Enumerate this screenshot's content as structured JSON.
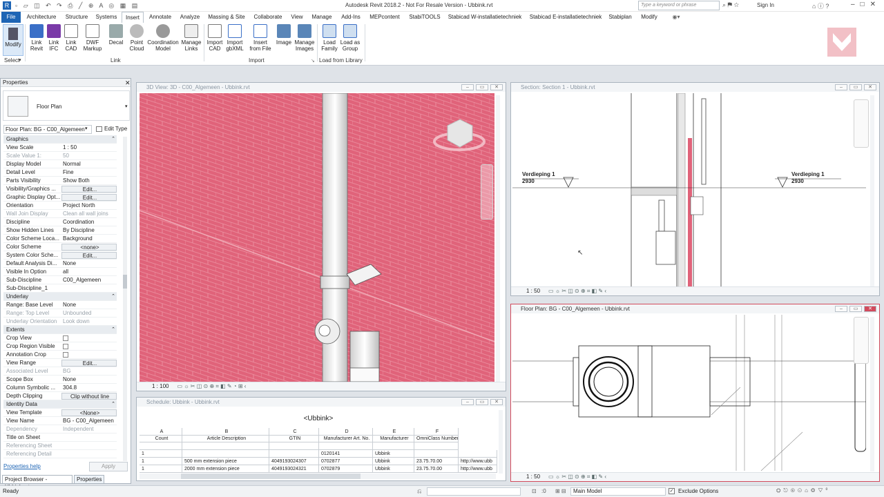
{
  "app": {
    "title": "Autodesk Revit 2018.2 - Not For Resale Version -    Ubbink.rvt",
    "search_placeholder": "Type a keyword or phrase",
    "sign_in": "Sign In"
  },
  "tabs": [
    "File",
    "Architecture",
    "Structure",
    "Systems",
    "Insert",
    "Annotate",
    "Analyze",
    "Massing & Site",
    "Collaborate",
    "View",
    "Manage",
    "Add-Ins",
    "MEPcontent",
    "StabiTOOLS",
    "Stabicad W-installatietechniek",
    "Stabicad E-installatietechniek",
    "Stabiplan",
    "Modify"
  ],
  "ribbon": {
    "modify": "Modify",
    "select": "Select",
    "link_group": "Link",
    "import_group": "Import",
    "library_group": "Load from Library",
    "buttons": [
      {
        "l1": "Link",
        "l2": "Revit"
      },
      {
        "l1": "Link",
        "l2": "IFC"
      },
      {
        "l1": "Link",
        "l2": "CAD"
      },
      {
        "l1": "DWF",
        "l2": "Markup"
      },
      {
        "l1": "Decal",
        "l2": ""
      },
      {
        "l1": "Point",
        "l2": "Cloud"
      },
      {
        "l1": "Coordination",
        "l2": "Model"
      },
      {
        "l1": "Manage",
        "l2": "Links"
      },
      {
        "l1": "Import",
        "l2": "CAD"
      },
      {
        "l1": "Import",
        "l2": "gbXML"
      },
      {
        "l1": "Insert",
        "l2": "from File"
      },
      {
        "l1": "Image",
        "l2": ""
      },
      {
        "l1": "Manage",
        "l2": "Images"
      },
      {
        "l1": "Load",
        "l2": "Family"
      },
      {
        "l1": "Load as",
        "l2": "Group"
      }
    ]
  },
  "properties": {
    "title": "Properties",
    "type": "Floor Plan",
    "selector": "Floor Plan: BG - C00_Algemeen",
    "edit_type": "Edit Type",
    "rows": [
      {
        "k": "Graphics",
        "v": "",
        "t": "sec"
      },
      {
        "k": "View Scale",
        "v": "1 : 50",
        "t": ""
      },
      {
        "k": "Scale Value    1:",
        "v": "50",
        "t": "dim"
      },
      {
        "k": "Display Model",
        "v": "Normal",
        "t": ""
      },
      {
        "k": "Detail Level",
        "v": "Fine",
        "t": ""
      },
      {
        "k": "Parts Visibility",
        "v": "Show Both",
        "t": ""
      },
      {
        "k": "Visibility/Graphics ...",
        "v": "Edit...",
        "t": "btn"
      },
      {
        "k": "Graphic Display Opt...",
        "v": "Edit...",
        "t": "btn"
      },
      {
        "k": "Orientation",
        "v": "Project North",
        "t": ""
      },
      {
        "k": "Wall Join Display",
        "v": "Clean all wall joins",
        "t": "dim"
      },
      {
        "k": "Discipline",
        "v": "Coordination",
        "t": ""
      },
      {
        "k": "Show Hidden Lines",
        "v": "By Discipline",
        "t": ""
      },
      {
        "k": "Color Scheme Loca...",
        "v": "Background",
        "t": ""
      },
      {
        "k": "Color Scheme",
        "v": "<none>",
        "t": "btn"
      },
      {
        "k": "System Color Sche...",
        "v": "Edit...",
        "t": "btn"
      },
      {
        "k": "Default Analysis Di...",
        "v": "None",
        "t": ""
      },
      {
        "k": "Visible In Option",
        "v": "all",
        "t": ""
      },
      {
        "k": "Sub-Discipline",
        "v": "C00_Algemeen",
        "t": ""
      },
      {
        "k": "Sub-Discipline_1",
        "v": "",
        "t": ""
      },
      {
        "k": "Underlay",
        "v": "",
        "t": "sec"
      },
      {
        "k": "Range: Base Level",
        "v": "None",
        "t": ""
      },
      {
        "k": "Range: Top Level",
        "v": "Unbounded",
        "t": "dim"
      },
      {
        "k": "Underlay Orientation",
        "v": "Look down",
        "t": "dim"
      },
      {
        "k": "Extents",
        "v": "",
        "t": "sec"
      },
      {
        "k": "Crop View",
        "v": "",
        "t": "check"
      },
      {
        "k": "Crop Region Visible",
        "v": "",
        "t": "check"
      },
      {
        "k": "Annotation Crop",
        "v": "",
        "t": "check"
      },
      {
        "k": "View Range",
        "v": "Edit...",
        "t": "btn"
      },
      {
        "k": "Associated Level",
        "v": "BG",
        "t": "dim"
      },
      {
        "k": "Scope Box",
        "v": "None",
        "t": ""
      },
      {
        "k": "Column Symbolic ...",
        "v": "304.8",
        "t": ""
      },
      {
        "k": "Depth Clipping",
        "v": "Clip without line",
        "t": "btn"
      },
      {
        "k": "Identity Data",
        "v": "",
        "t": "sec"
      },
      {
        "k": "View Template",
        "v": "<None>",
        "t": "btn"
      },
      {
        "k": "View Name",
        "v": "BG - C00_Algemeen",
        "t": ""
      },
      {
        "k": "Dependency",
        "v": "Independent",
        "t": "dim"
      },
      {
        "k": "Title on Sheet",
        "v": "",
        "t": ""
      },
      {
        "k": "Referencing Sheet",
        "v": "",
        "t": "dim"
      },
      {
        "k": "Referencing Detail",
        "v": "",
        "t": "dim"
      }
    ],
    "help": "Properties help",
    "apply": "Apply"
  },
  "bottom_tabs": [
    "Project Browser - Ubbink.rvt",
    "Properties"
  ],
  "views": {
    "v3d": {
      "title": "3D View: 3D - C00_Algemeen - Ubbink.rvt",
      "scale": "1 : 100"
    },
    "section": {
      "title": "Section: Section 1 - Ubbink.rvt",
      "scale": "1 : 50",
      "level": "Verdieping 1",
      "elev": "2930"
    },
    "plan": {
      "title": "Floor Plan: BG - C00_Algemeen - Ubbink.rvt",
      "scale": "1 : 50"
    },
    "schedule": {
      "title": "Schedule: Ubbink - Ubbink.rvt",
      "name": "<Ubbink>",
      "letters": [
        "A",
        "B",
        "C",
        "D",
        "E",
        "F"
      ],
      "headers": [
        "Count",
        "Article Description",
        "GTIN",
        "Manufacturer Art. No.",
        "Manufacturer",
        "OmniClass Number"
      ],
      "rows": [
        [
          "",
          "",
          "",
          "",
          "",
          ""
        ],
        [
          "1",
          "",
          "",
          "0120141",
          "Ubbink",
          "",
          ""
        ],
        [
          "1",
          "500 mm extension piece",
          "4049193024307",
          "0702877",
          "Ubbink",
          "23.75.70.00",
          "http://www.ubb"
        ],
        [
          "1",
          "2000 mm extension piece",
          "4049193024321",
          "0702879",
          "Ubbink",
          "23.75.70.00",
          "http://www.ubb"
        ]
      ]
    }
  },
  "status": {
    "ready": "Ready",
    "zero": ":0",
    "model": "Main Model",
    "exclude": "Exclude Options"
  },
  "colors": {
    "brick": "#e0637a",
    "file": "#1e65b5"
  }
}
